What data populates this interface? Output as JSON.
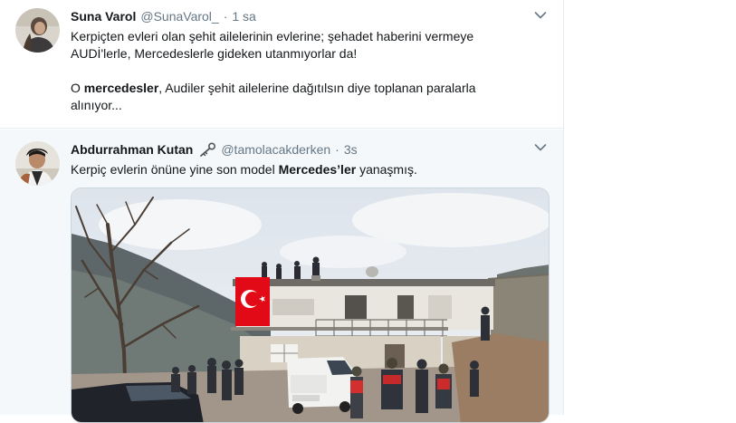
{
  "tweets": [
    {
      "name": "Suna Varol",
      "handle": "@SunaVarol_",
      "dot": "·",
      "time": "1 sa",
      "line1": "Kerpiçten evleri olan şehit ailelerinin evlerine; şehadet haberini vermeye",
      "line2": "AUDİ'lerle, Mercedeslerle gideken utanmıyorlar da!",
      "line3_prefix": "O ",
      "line3_bold": "mercedesler",
      "line3_suffix": ", Audiler şehit ailelerine dağıtılsın diye toplanan paralarla",
      "line4": "alınıyor..."
    },
    {
      "name": "Abdurrahman Kutan",
      "handle": "@tamolacakderken",
      "dot": "·",
      "time": "3s",
      "text_prefix": "Kerpiç evlerin önüne yine son model ",
      "text_bold": "Mercedes’ler",
      "text_suffix": " yanaşmış."
    }
  ],
  "icons": {
    "chevron": "chevron-down-icon",
    "badge": "key-icon"
  },
  "colors": {
    "secondary_text": "#657786",
    "selected_background": "#f5f8fa",
    "border": "#e6ecf0",
    "flag_red": "#e30a17"
  }
}
